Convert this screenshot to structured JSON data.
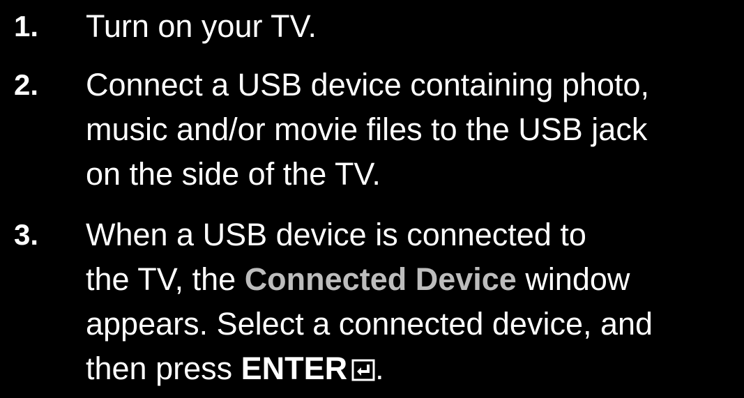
{
  "steps": [
    {
      "number": "1.",
      "lines": [
        "Turn on your TV."
      ]
    },
    {
      "number": "2.",
      "lines": [
        "Connect a USB device containing photo,",
        "music and/or movie files to the USB jack",
        "on the side of the TV."
      ]
    },
    {
      "number": "3.",
      "line1": "When a USB device is connected to",
      "line2_pre": "the TV, the ",
      "line2_highlight": "Connected Device",
      "line2_post": " window",
      "line3": "appears. Select a connected device, and",
      "line4_pre": "then press ",
      "line4_bold": "ENTER",
      "line4_post": ".",
      "icon": "enter-icon"
    }
  ],
  "colors": {
    "background": "#000000",
    "text": "#ffffff",
    "highlight": "#bdbdbd"
  }
}
